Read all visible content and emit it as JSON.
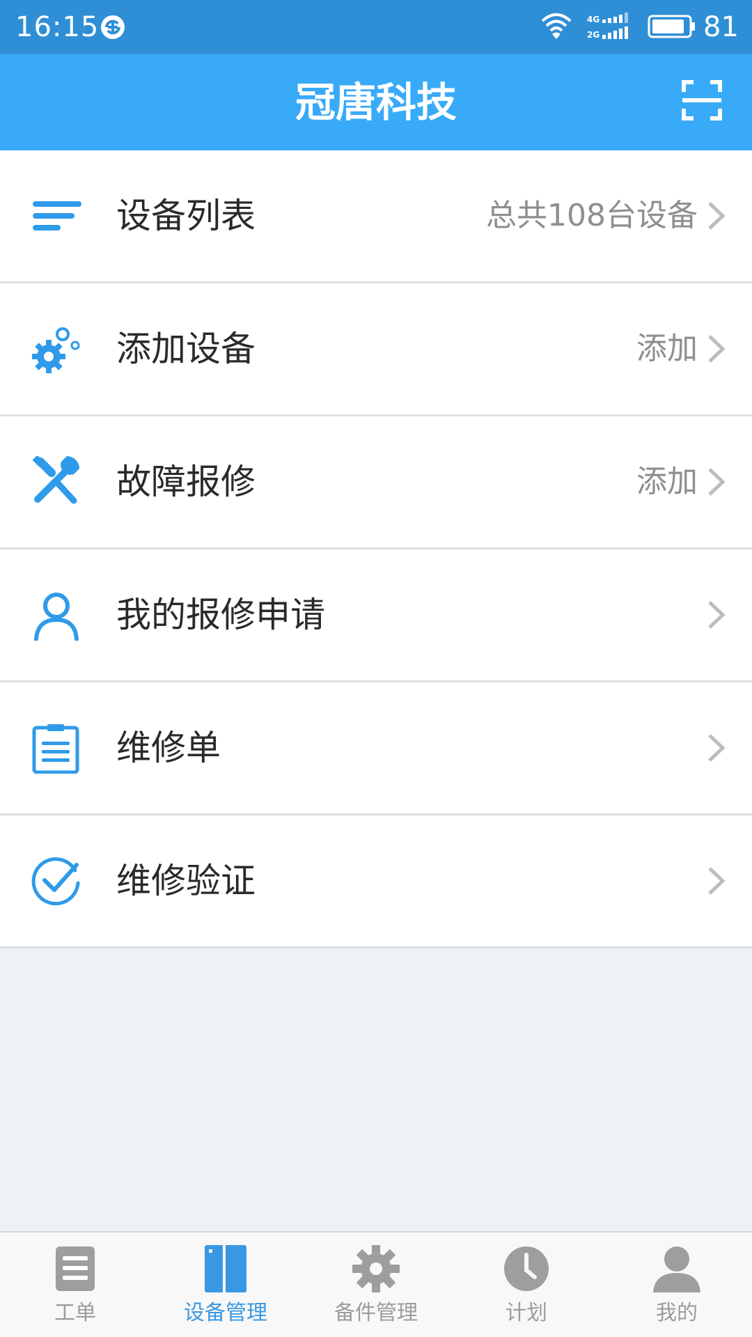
{
  "status_bar": {
    "time": "16:15",
    "network": "4G 2G",
    "battery": "81"
  },
  "header": {
    "title": "冠唐科技",
    "scan_icon": "scan-icon"
  },
  "menu": [
    {
      "label": "设备列表",
      "value": "总共108台设备",
      "icon": "list-icon"
    },
    {
      "label": "添加设备",
      "value": "添加",
      "icon": "gears-icon"
    },
    {
      "label": "故障报修",
      "value": "添加",
      "icon": "tools-icon"
    },
    {
      "label": "我的报修申请",
      "value": "",
      "icon": "user-icon"
    },
    {
      "label": "维修单",
      "value": "",
      "icon": "clipboard-icon"
    },
    {
      "label": "维修验证",
      "value": "",
      "icon": "check-circle-icon"
    }
  ],
  "tabs": [
    {
      "label": "工单",
      "icon": "document-icon",
      "active": false
    },
    {
      "label": "设备管理",
      "icon": "device-icon",
      "active": true
    },
    {
      "label": "备件管理",
      "icon": "gear-icon",
      "active": false
    },
    {
      "label": "计划",
      "icon": "clock-icon",
      "active": false
    },
    {
      "label": "我的",
      "icon": "person-icon",
      "active": false
    }
  ],
  "colors": {
    "primary": "#39aaf8",
    "status_bar": "#2f8fd6",
    "icon_blue": "#2f9ae9",
    "tab_active": "#3a98e2",
    "tab_inactive": "#9c9c9c",
    "background": "#eff2f4"
  }
}
